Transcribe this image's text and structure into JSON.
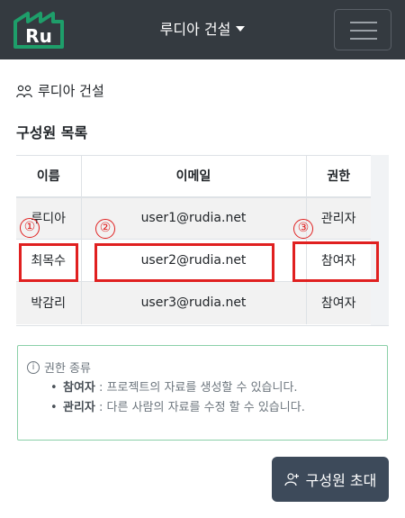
{
  "navbar": {
    "logo_text": "Ru",
    "brand": "루디아 건설",
    "colors": {
      "background": "#343a40",
      "logo_green": "#1e9e6a"
    }
  },
  "team": {
    "icon": "people-icon",
    "name": "루디아 건설"
  },
  "section_title": "구성원 목록",
  "table": {
    "headers": [
      "이름",
      "이메일",
      "권한"
    ],
    "rows": [
      {
        "name": "루디아",
        "email": "user1@rudia.net",
        "role": "관리자"
      },
      {
        "name": "최목수",
        "email": "user2@rudia.net",
        "role": "참여자"
      },
      {
        "name": "박감리",
        "email": "user3@rudia.net",
        "role": "참여자"
      }
    ]
  },
  "annotations": [
    "①",
    "②",
    "③"
  ],
  "info": {
    "title": "권한 종류",
    "items": [
      {
        "term": "참여자",
        "desc": " : 프로젝트의 자료를 생성할 수 있습니다."
      },
      {
        "term": "관리자",
        "desc": " : 다른 사람의 자료를 수정 할 수 있습니다."
      }
    ]
  },
  "invite_button": {
    "icon": "person-add-icon",
    "label": "구성원 초대"
  }
}
